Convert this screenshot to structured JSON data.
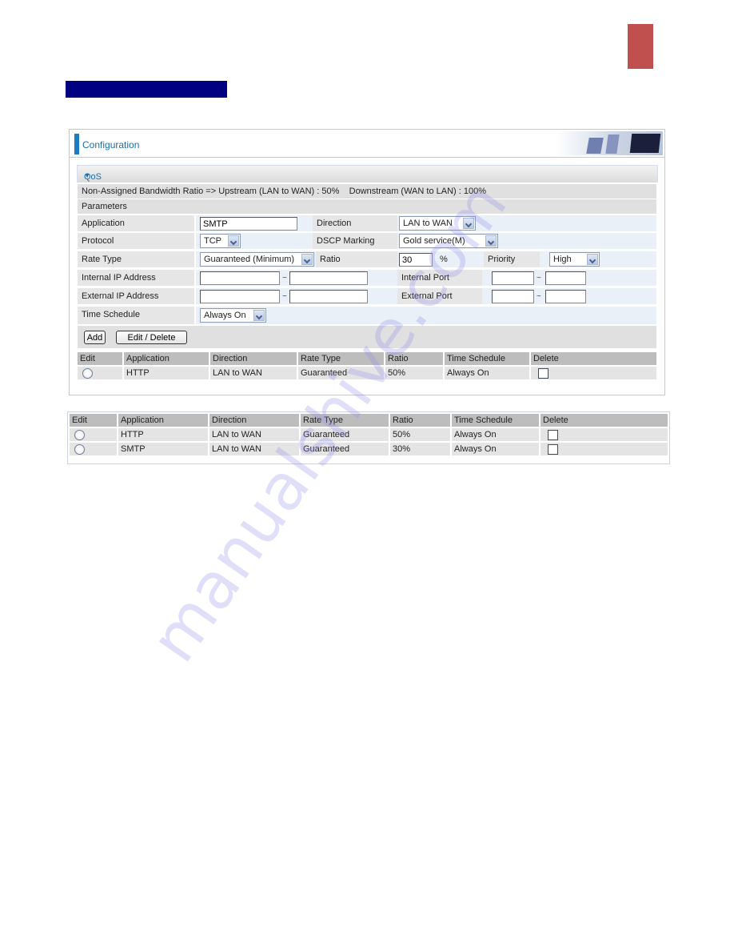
{
  "panel": {
    "title": "Configuration",
    "section": "QoS",
    "bandwidth_info": "Non-Assigned Bandwidth Ratio => Upstream (LAN to WAN) : 50%    Downstream (WAN to LAN) : 100%",
    "parameters_label": "Parameters"
  },
  "form": {
    "application": {
      "label": "Application",
      "value": "SMTP"
    },
    "direction": {
      "label": "Direction",
      "value": "LAN to WAN"
    },
    "protocol": {
      "label": "Protocol",
      "value": "TCP"
    },
    "dscp": {
      "label": "DSCP Marking",
      "value": "Gold service(M)"
    },
    "rate_type": {
      "label": "Rate Type",
      "value": "Guaranteed (Minimum)"
    },
    "ratio": {
      "label": "Ratio",
      "value": "30",
      "unit": "%"
    },
    "priority": {
      "label": "Priority",
      "value": "High"
    },
    "internal_ip": {
      "label": "Internal IP Address",
      "from": "",
      "to": "",
      "sep": "~"
    },
    "external_ip": {
      "label": "External IP Address",
      "from": "",
      "to": "",
      "sep": "~"
    },
    "internal_port": {
      "label": "Internal Port",
      "from": "",
      "to": "",
      "sep": "~"
    },
    "external_port": {
      "label": "External Port",
      "from": "",
      "to": "",
      "sep": "~"
    },
    "time_schedule": {
      "label": "Time Schedule",
      "value": "Always On"
    },
    "add_label": "Add",
    "edit_delete_label": "Edit / Delete"
  },
  "columns": [
    "Edit",
    "Application",
    "Direction",
    "Rate Type",
    "Ratio",
    "Time Schedule",
    "Delete"
  ],
  "table_before": [
    {
      "application": "HTTP",
      "direction": "LAN to WAN",
      "rate_type": "Guaranteed",
      "ratio": "50%",
      "schedule": "Always On"
    }
  ],
  "table_after": [
    {
      "application": "HTTP",
      "direction": "LAN to WAN",
      "rate_type": "Guaranteed",
      "ratio": "50%",
      "schedule": "Always On"
    },
    {
      "application": "SMTP",
      "direction": "LAN to WAN",
      "rate_type": "Guaranteed",
      "ratio": "30%",
      "schedule": "Always On"
    }
  ],
  "watermark": "manualshive.com",
  "colors": {
    "page_tab": "#c0504d",
    "section_bar": "#000080",
    "accent": "#1a7bbf"
  }
}
